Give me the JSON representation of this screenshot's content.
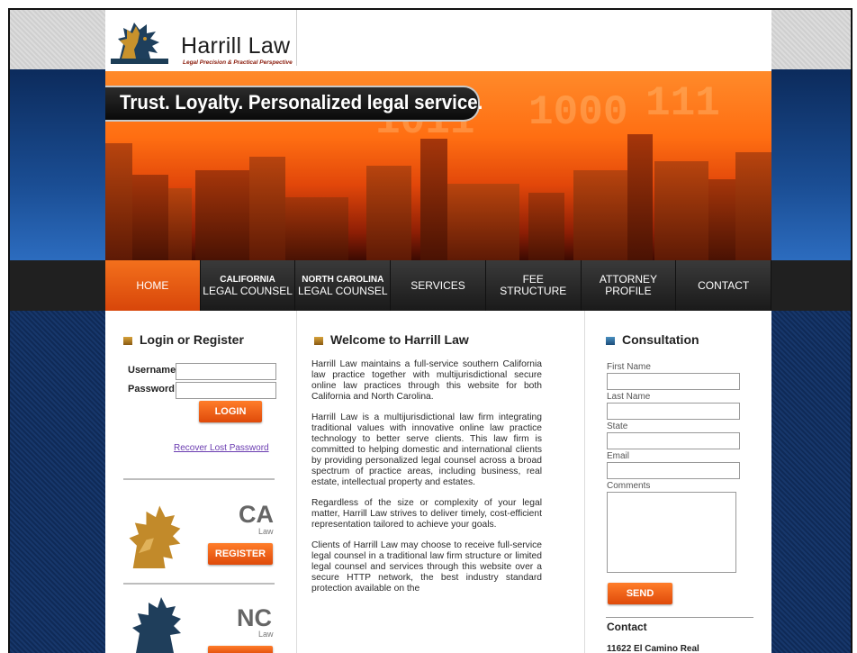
{
  "header": {
    "brand": "Harrill Law",
    "tagline": "Legal Precision & Practical Perspective",
    "logo_icon": "lion-crest-icon"
  },
  "hero": {
    "slogan": "Trust. Loyalty. Personalized legal service."
  },
  "nav": {
    "items": [
      {
        "label": "HOME",
        "active": true
      },
      {
        "line1": "CALIFORNIA",
        "line2": "LEGAL COUNSEL"
      },
      {
        "line1": "NORTH CAROLINA",
        "line2": "LEGAL COUNSEL"
      },
      {
        "label": "SERVICES"
      },
      {
        "line1": "FEE",
        "line2": "STRUCTURE"
      },
      {
        "line1": "ATTORNEY",
        "line2": "PROFILE"
      },
      {
        "label": "CONTACT"
      }
    ]
  },
  "login": {
    "title": "Login or Register",
    "username_label": "Username",
    "password_label": "Password",
    "username_value": "",
    "password_value": "",
    "login_button": "LOGIN",
    "recover_link": "Recover Lost Password"
  },
  "ca": {
    "code": "CA",
    "sub": "Law",
    "register_button": "REGISTER"
  },
  "nc": {
    "code": "NC",
    "sub": "Law"
  },
  "welcome": {
    "title": "Welcome to Harrill Law",
    "p1": "Harrill Law maintains a full-service southern California law practice together with multijurisdictional secure online law practices through this website for both California and North Carolina.",
    "p2": "Harrill Law is a multijurisdictional law firm integrating traditional values with innovative online law practice technology to better serve clients. This law firm is committed to helping domestic and international clients by providing personalized legal counsel across a broad spectrum of practice areas, including business, real estate, intellectual property and estates.",
    "p3": "Regardless of the size or complexity of your legal matter, Harrill Law strives to deliver timely, cost-efficient representation tailored to achieve your goals.",
    "p4": "Clients of Harrill Law may choose to receive full-service legal counsel in a traditional law firm structure or limited legal counsel and services through this website over a secure HTTP network, the best industry standard protection available on the"
  },
  "consult": {
    "title": "Consultation",
    "first_name": "First Name",
    "last_name": "Last Name",
    "state": "State",
    "email": "Email",
    "comments": "Comments",
    "send_button": "SEND",
    "contact_title": "Contact",
    "address_line1": "11622 El Camino Real"
  },
  "colors": {
    "accent": "#ef6a1a",
    "nav_bg": "#202020",
    "navy": "#0f2a57"
  }
}
